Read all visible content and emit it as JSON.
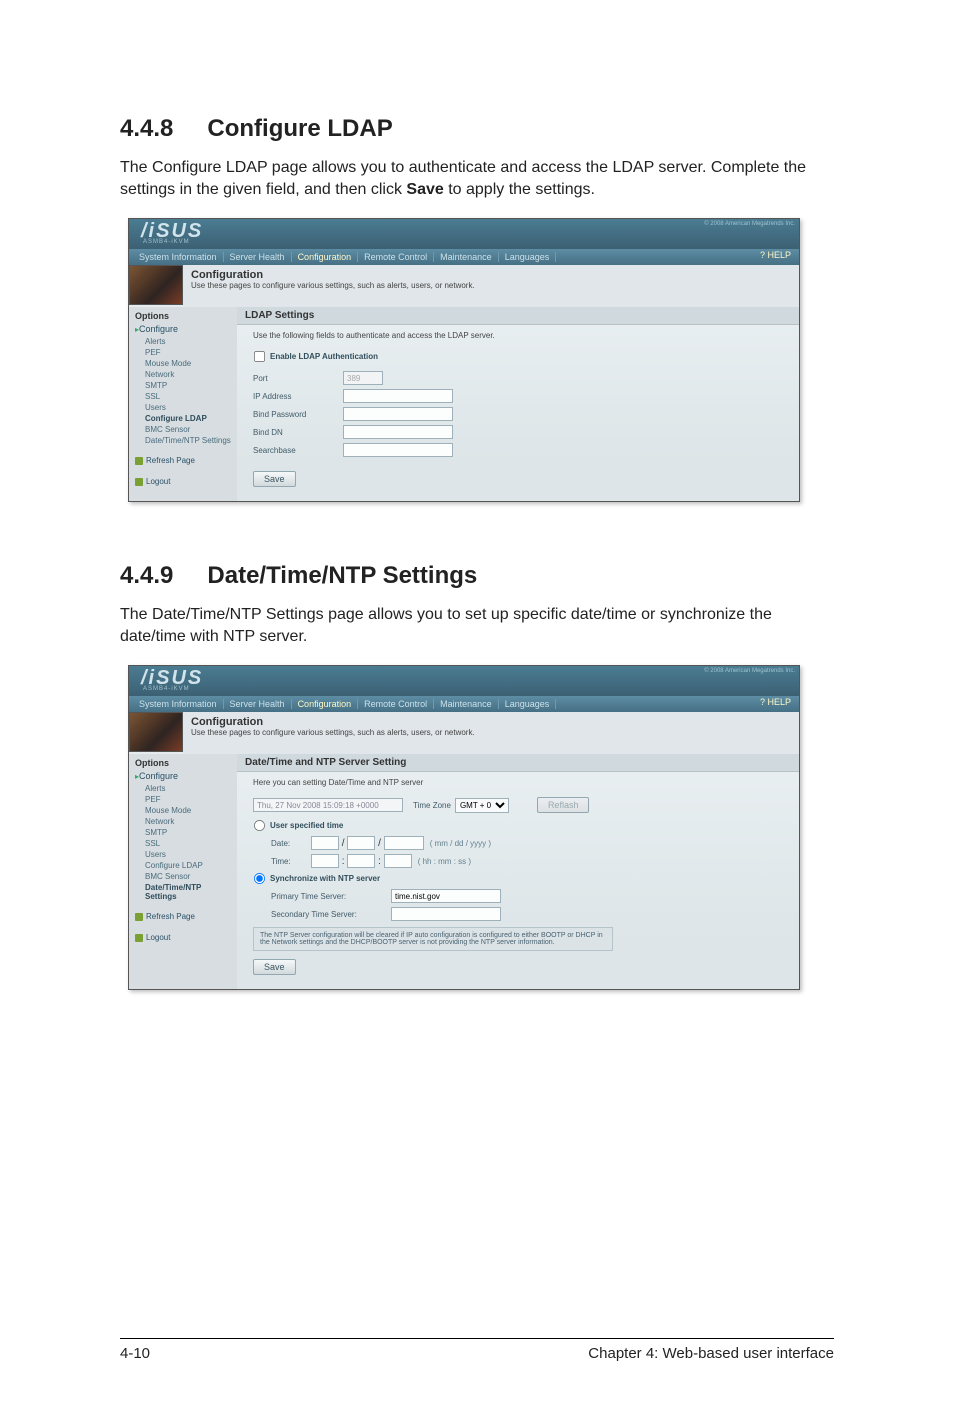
{
  "section1": {
    "num": "4.4.8",
    "title": "Configure LDAP",
    "intro_a": "The Configure LDAP page allows you to authenticate and access the LDAP server. Complete the settings in the given field, and then click ",
    "intro_bold": "Save",
    "intro_b": " to apply the settings."
  },
  "section2": {
    "num": "4.4.9",
    "title": "Date/Time/NTP Settings",
    "intro": "The Date/Time/NTP Settings page allows you to set up specific date/time or synchronize the date/time with NTP server."
  },
  "ss_common": {
    "logo": "/iSUS",
    "logo_sub": "ASMB4-iKVM",
    "topright": "© 2008 American Megatrends Inc.",
    "menu": {
      "sysinfo": "System Information",
      "health": "Server Health",
      "config": "Configuration",
      "remote": "Remote Control",
      "maint": "Maintenance",
      "lang": "Languages"
    },
    "help": "? HELP",
    "cfg_title": "Configuration",
    "cfg_desc": "Use these pages to configure various settings, such as alerts, users, or network.",
    "sidebar": {
      "options": "Options",
      "configure": "Configure",
      "alerts": "Alerts",
      "pef": "PEF",
      "mouse": "Mouse Mode",
      "network": "Network",
      "smtp": "SMTP",
      "ssl": "SSL",
      "users": "Users",
      "ldap": "Configure LDAP",
      "bmc": "BMC Sensor",
      "dtntp": "Date/Time/NTP Settings",
      "dtntp_short": "Date/Time/NTP\nSettings",
      "refresh": "Refresh Page",
      "logout": "Logout"
    }
  },
  "ss1": {
    "panel_title": "LDAP Settings",
    "desc": "Use the following fields to authenticate and access the LDAP server.",
    "enable": "Enable LDAP Authentication",
    "port": "Port",
    "port_val": "389",
    "ip": "IP Address",
    "bindpw": "Bind Password",
    "binddn": "Bind DN",
    "searchbase": "Searchbase",
    "save": "Save"
  },
  "ss2": {
    "panel_title": "Date/Time and NTP Server Setting",
    "desc": "Here you can setting Date/Time and NTP server",
    "date_display": "Thu, 27 Nov 2008 15:09:18 +0000",
    "tz_label": "Time Zone",
    "tz_val": "GMT + 0",
    "reflash": "Reflash",
    "user_spec": "User specified time",
    "date_lbl": "Date:",
    "date_hint": "( mm / dd / yyyy )",
    "time_lbl": "Time:",
    "time_hint": "( hh : mm : ss )",
    "sync": "Synchronize with NTP server",
    "primary": "Primary Time Server:",
    "primary_val": "time.nist.gov",
    "secondary": "Secondary Time Server:",
    "note": "The NTP Server configuration will be cleared if IP auto configuration is configured to either BOOTP or DHCP in the Network settings and the DHCP/BOOTP server is not providing the NTP server information.",
    "save": "Save"
  },
  "footer": {
    "left": "4-10",
    "right": "Chapter 4: Web-based user interface"
  }
}
